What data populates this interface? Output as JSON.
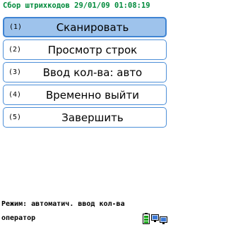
{
  "window": {
    "title": "Сбор штрихкодов 29/01/09 01:08:19"
  },
  "menu": {
    "items": [
      {
        "number": "(1)",
        "label": "Сканировать",
        "selected": true
      },
      {
        "number": "(2)",
        "label": "Просмотр строк",
        "selected": false
      },
      {
        "number": "(3)",
        "label": "Ввод кол-ва: авто",
        "selected": false
      },
      {
        "number": "(4)",
        "label": "Временно выйти",
        "selected": false
      },
      {
        "number": "(5)",
        "label": "Завершить",
        "selected": false
      }
    ]
  },
  "status": {
    "mode_text": "Режим:  автоматич. ввод кол-ва"
  },
  "footer": {
    "user": "оператор",
    "icons": [
      "battery-icon",
      "network-icon"
    ]
  },
  "colors": {
    "title_text": "#008a3b",
    "button_border": "#4d8fd8",
    "selected_fill": "#9ec3ec"
  }
}
